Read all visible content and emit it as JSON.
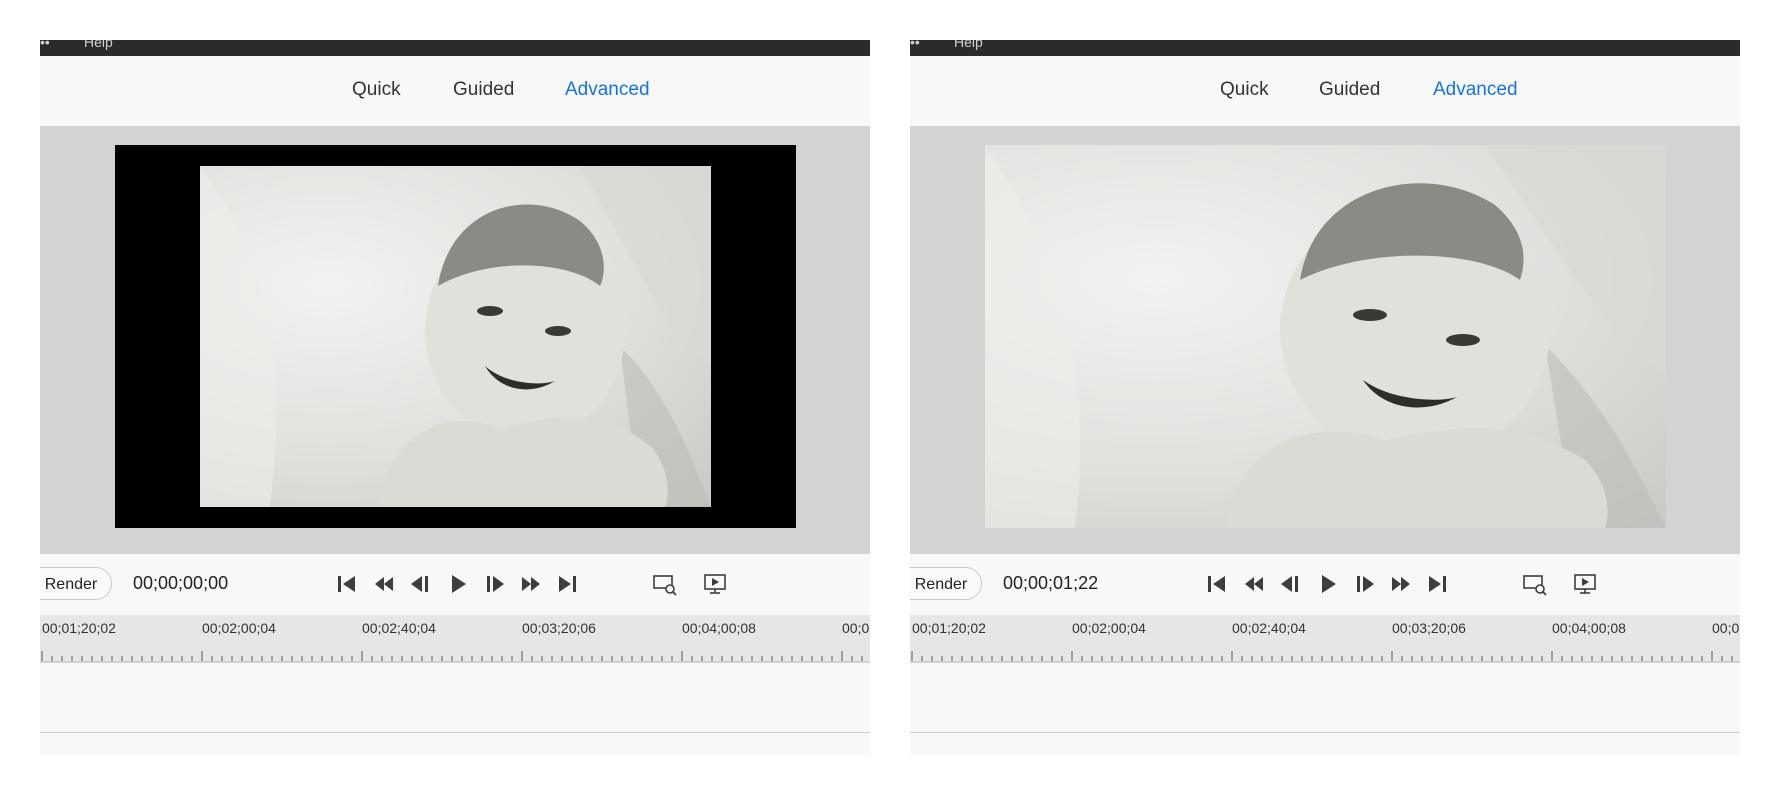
{
  "panels": [
    {
      "menu_help": "Help",
      "tabs": [
        "Quick",
        "Guided",
        "Advanced"
      ],
      "active_tab": "Advanced",
      "render_label": "Render",
      "timecode": "00;00;00;00",
      "ruler_labels": [
        "00;01;20;02",
        "00;02;00;04",
        "00;02;40;04",
        "00;03;20;06",
        "00;04;00;08",
        "00;0"
      ],
      "preview_mode": "letterboxed"
    },
    {
      "menu_help": "Help",
      "tabs": [
        "Quick",
        "Guided",
        "Advanced"
      ],
      "active_tab": "Advanced",
      "render_label": "Render",
      "timecode": "00;00;01;22",
      "ruler_labels": [
        "00;01;20;02",
        "00;02;00;04",
        "00;02;40;04",
        "00;03;20;06",
        "00;04;00;08",
        "00;0"
      ],
      "preview_mode": "fullframe"
    }
  ],
  "transport_icons": [
    "go-to-start-icon",
    "step-back-icon",
    "frame-back-icon",
    "play-icon",
    "frame-forward-icon",
    "step-forward-icon",
    "go-to-end-icon"
  ],
  "monitor_icons": [
    "zoom-preview-icon",
    "fullscreen-preview-icon"
  ],
  "colors": {
    "accent": "#1473e6",
    "menubar": "#2b2b2b",
    "preview_bg": "#d3d3d3",
    "ruler_bg": "#e6e6e6"
  }
}
